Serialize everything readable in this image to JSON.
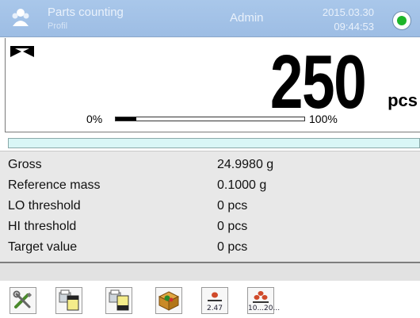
{
  "header": {
    "mode_title": "Parts counting",
    "mode_subtitle": "Profil",
    "user": "Admin",
    "date": "2015.03.30",
    "time": "09:44:53",
    "status_color": "#1db52a"
  },
  "weighing": {
    "value": "250",
    "unit": "pcs",
    "bar_min_label": "0%",
    "bar_max_label": "100%",
    "bar_fill_fraction": 0.11
  },
  "info": {
    "rows": [
      {
        "label": "Gross",
        "value": "24.9980 g"
      },
      {
        "label": "Reference mass",
        "value": "0.1000 g"
      },
      {
        "label": "LO threshold",
        "value": "0 pcs"
      },
      {
        "label": "HI threshold",
        "value": "0 pcs"
      },
      {
        "label": "Target value",
        "value": "0 pcs"
      }
    ]
  },
  "toolbar": {
    "buttons": [
      {
        "icon": "tools-icon"
      },
      {
        "icon": "printer-header-icon"
      },
      {
        "icon": "printer-footer-icon"
      },
      {
        "icon": "package-icon"
      },
      {
        "icon": "piece-mass-icon",
        "text": "2.47"
      },
      {
        "icon": "set-quantity-icon",
        "text": "10...20..."
      }
    ]
  }
}
